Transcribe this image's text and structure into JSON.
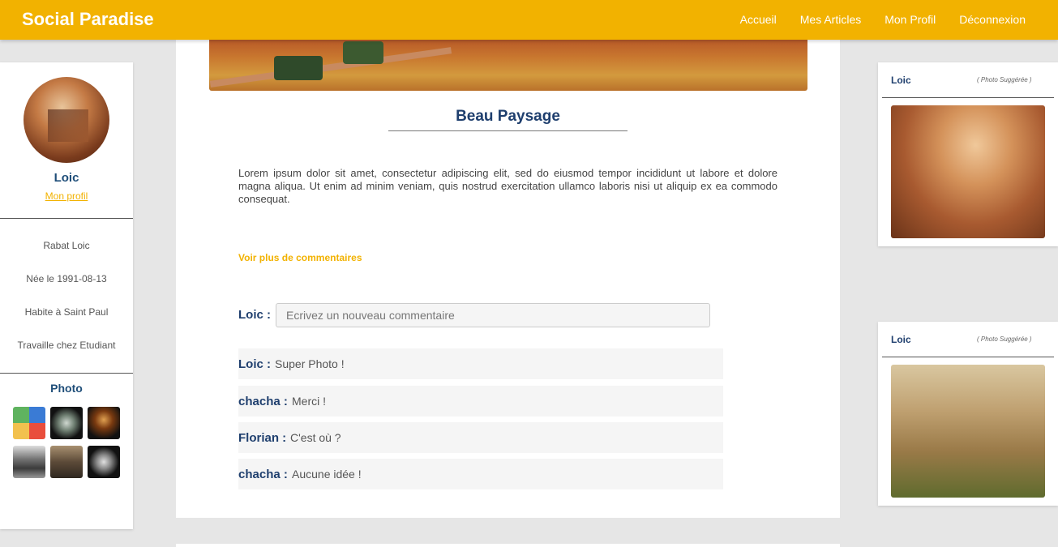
{
  "app": {
    "brand": "Social Paradise"
  },
  "nav": [
    "Accueil",
    "Mes Articles",
    "Mon Profil",
    "Déconnexion"
  ],
  "profile": {
    "name": "Loic",
    "link": "Mon profil",
    "info": [
      "Rabat Loic",
      "Née le 1991-08-13",
      "Habite à Saint Paul",
      "Travaille chez Etudiant"
    ],
    "photos_title": "Photo"
  },
  "post": {
    "title": "Beau Paysage",
    "body": "Lorem ipsum dolor sit amet, consectetur adipiscing elit, sed do eiusmod tempor incididunt ut labore et dolore magna aliqua. Ut enim ad minim veniam, quis nostrud exercitation ullamco laboris nisi ut aliquip ex ea commodo consequat.",
    "more_comments": "Voir plus de commentaires",
    "current_user": "Loic :",
    "comment_placeholder": "Ecrivez un nouveau commentaire",
    "comments": [
      {
        "author": "Loic :",
        "text": "Super Photo !"
      },
      {
        "author": "chacha :",
        "text": "Merci !"
      },
      {
        "author": "Florian :",
        "text": "C'est où ?"
      },
      {
        "author": "chacha :",
        "text": "Aucune idée !"
      }
    ]
  },
  "suggestions": [
    {
      "user": "Loic",
      "label": "( Photo Suggérée )"
    },
    {
      "user": "Loic",
      "label": "( Photo Suggérée )"
    }
  ]
}
